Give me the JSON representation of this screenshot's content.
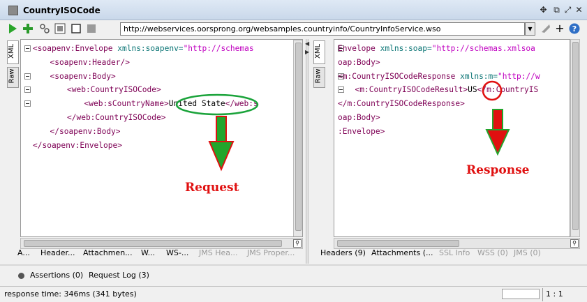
{
  "window": {
    "title": "CountryISOCode",
    "controls": [
      "pin-icon",
      "restore-icon",
      "maximize-icon",
      "close-icon"
    ]
  },
  "toolbar": {
    "endpoint_url": "http://webservices.oorsprong.org/websamples.countryinfo/CountryInfoService.wso",
    "buttons": [
      "run-icon",
      "add-icon",
      "link-icon",
      "format-icon",
      "stop-icon",
      "disabled-icon"
    ]
  },
  "request": {
    "vtabs": [
      "XML",
      "Raw"
    ],
    "lines": [
      {
        "indent": 0,
        "open": "<soapenv:Envelope",
        "attr": " xmlns:soapenv=",
        "str": "\"http://schemas"
      },
      {
        "indent": 1,
        "open": "<soapenv:Header/>"
      },
      {
        "indent": 1,
        "open": "<soapenv:Body>"
      },
      {
        "indent": 2,
        "open": "<web:CountryISOCode>"
      },
      {
        "indent": 3,
        "open": "<web:sCountryName>",
        "text": "United State",
        "close": "</web:s"
      },
      {
        "indent": 2,
        "open": "</web:CountryISOCode>"
      },
      {
        "indent": 1,
        "open": "</soapenv:Body>"
      },
      {
        "indent": 0,
        "open": "</soapenv:Envelope>"
      }
    ],
    "bottom_tabs": [
      "A...",
      "Header...",
      "Attachmen...",
      "W...",
      "WS-...",
      "JMS Hea...",
      "JMS Proper..."
    ],
    "annotation": "Request"
  },
  "response": {
    "vtabs": [
      "XML",
      "Raw"
    ],
    "lines": [
      {
        "indent": 0,
        "open": "Envelope",
        "attr": " xmlns:soap=",
        "str": "\"http://schemas.xmlsoa"
      },
      {
        "indent": 0,
        "open": "oap:Body>"
      },
      {
        "indent": 0,
        "open": "<m:CountryISOCodeResponse",
        "attr": " xmlns:m=",
        "str": "\"http://w"
      },
      {
        "indent": 1,
        "open": "<m:CountryISOCodeResult>",
        "text": "US",
        "close": "</m:CountryIS"
      },
      {
        "indent": 0,
        "open": "</m:CountryISOCodeResponse>"
      },
      {
        "indent": 0,
        "open": "oap:Body>"
      },
      {
        "indent": 0,
        "open": ":Envelope>"
      }
    ],
    "bottom_tabs": [
      "Headers (9)",
      "Attachments (...",
      "SSL Info",
      "WSS (0)",
      "JMS (0)"
    ],
    "annotation": "Response"
  },
  "log_tabs": {
    "assertions": "Assertions (0)",
    "request_log": "Request Log (3)"
  },
  "status": {
    "response_time": "response time: 346ms (341 bytes)",
    "cursor": "1 : 1"
  },
  "colors": {
    "tag": "#7e0055",
    "attr": "#0b7575",
    "string": "#c000c0",
    "annotation": "#e01010",
    "highlight_ellipse": "#1aa33a",
    "arrow": "#22a52c"
  }
}
